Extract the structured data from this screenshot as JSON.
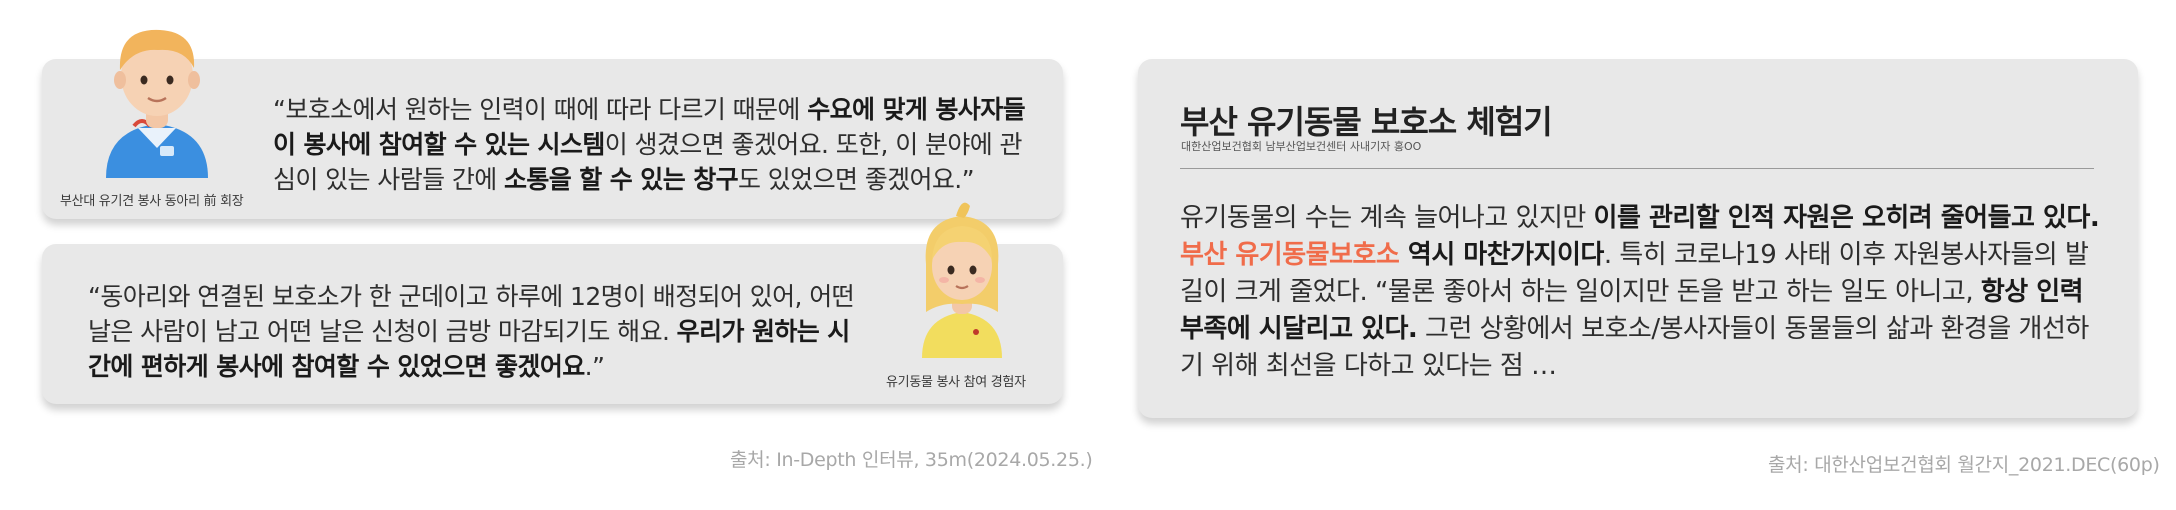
{
  "card1": {
    "quote": [
      {
        "t": "“보호소에서 원하는 인력이 때에 따라 다르기 때문에 ",
        "b": false
      },
      {
        "t": "수요에 맞게 봉사자들이 봉사에 참여할 수 있는 시스템",
        "b": true
      },
      {
        "t": "이 생겼으면 좋겠어요. 또한, 이 분야에 관심이 있는 사람들 간에 ",
        "b": false
      },
      {
        "t": "소통을 할 수 있는 창구",
        "b": true
      },
      {
        "t": "도 있었으면 좋겠어요.”",
        "b": false
      }
    ],
    "caption": "부산대 유기견 봉사 동아리 前 회장",
    "avatar_icon": "male-volunteer-avatar"
  },
  "card2": {
    "quote": [
      {
        "t": "“동아리와 연결된 보호소가 한 군데이고 하루에 12명이 배정되어 있어, 어떤 날은 사람이 남고 어떤 날은 신청이 금방 마감되기도 해요. ",
        "b": false
      },
      {
        "t": "우리가 원하는 시간에 편하게 봉사에 참여할 수 있었으면 좋겠어요",
        "b": true
      },
      {
        "t": ".”",
        "b": false
      }
    ],
    "caption": "유기동물 봉사 참여 경험자",
    "avatar_icon": "female-volunteer-avatar"
  },
  "source_left": "출처: In-Depth 인터뷰, 35m(2024.05.25.)",
  "right": {
    "title": "부산 유기동물 보호소 체험기",
    "subtitle": "대한산업보건협회 남부산업보건센터 사내기자 홍OO",
    "body": [
      {
        "t": "유기동물의 수는 계속 늘어나고 있지만 ",
        "s": "normal"
      },
      {
        "t": "이를 관리할 인적 자원은 오히려 줄어들고 있다. ",
        "s": "bold"
      },
      {
        "t": "부산 유기동물보호소",
        "s": "accent"
      },
      {
        "t": " 역시 마찬가지이다",
        "s": "bold"
      },
      {
        "t": ". 특히 코로나19 사태 이후 자원봉사자들의 발길이 크게 줄었다. “물론 좋아서 하는 일이지만 돈을 받고 하는 일도 아니고, ",
        "s": "normal"
      },
      {
        "t": "항상 인력 부족에 시달리고 있다.",
        "s": "bold"
      },
      {
        "t": " 그런 상황에서 보호소/봉사자들이 동물들의 삶과 환경을 개선하기 위해 최선을 다하고 있다는 점 …",
        "s": "normal"
      }
    ]
  },
  "source_right": "출처: 대한산업보건협회 월간지_2021.DEC(60p)",
  "colors": {
    "card_bg": "#e8e8e8",
    "accent": "#f06c4a",
    "source_text": "#a8a8a8"
  }
}
